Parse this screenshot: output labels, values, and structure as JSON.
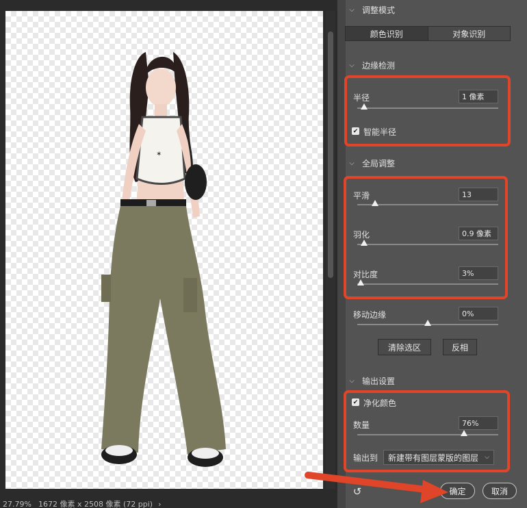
{
  "status": {
    "zoom": "27.79%",
    "doc_info": "1672 像素 x 2508 像素 (72 ppi)",
    "chev": "›"
  },
  "sections": {
    "adjust_mode": "调整模式",
    "edge_detect": "边缘检测",
    "global_adjust": "全局调整",
    "output_settings": "输出设置"
  },
  "mode_tabs": [
    "颜色识别",
    "对象识别"
  ],
  "edge": {
    "radius_label": "半径",
    "radius_value": "1 像素",
    "radius_level": 0.05,
    "smart_radius_label": "智能半径",
    "smart_radius_checked": true
  },
  "global": {
    "smooth_label": "平滑",
    "smooth_value": "13",
    "smooth_level": 0.13,
    "feather_label": "羽化",
    "feather_value": "0.9 像素",
    "feather_level": 0.05,
    "contrast_label": "对比度",
    "contrast_value": "3%",
    "contrast_level": 0.03,
    "shift_label": "移动边缘",
    "shift_value": "0%",
    "shift_level": 0.5,
    "clear_selection": "清除选区",
    "invert": "反相"
  },
  "output": {
    "decontaminate_label": "净化颜色",
    "decontaminate_checked": true,
    "amount_label": "数量",
    "amount_value": "76%",
    "amount_level": 0.76,
    "output_to_label": "输出到",
    "output_to_value": "新建带有图层蒙版的图层"
  },
  "footer": {
    "ok": "确定",
    "cancel": "取消"
  },
  "icons": {
    "reset": "reset-icon",
    "checkbox": "checkmark-icon",
    "dropdown": "chevron-down-icon",
    "section": "chevron-down-icon"
  },
  "colors": {
    "highlight": "#e0452a",
    "panel_bg": "#535353",
    "canvas_bg": "#2b2b2b"
  }
}
